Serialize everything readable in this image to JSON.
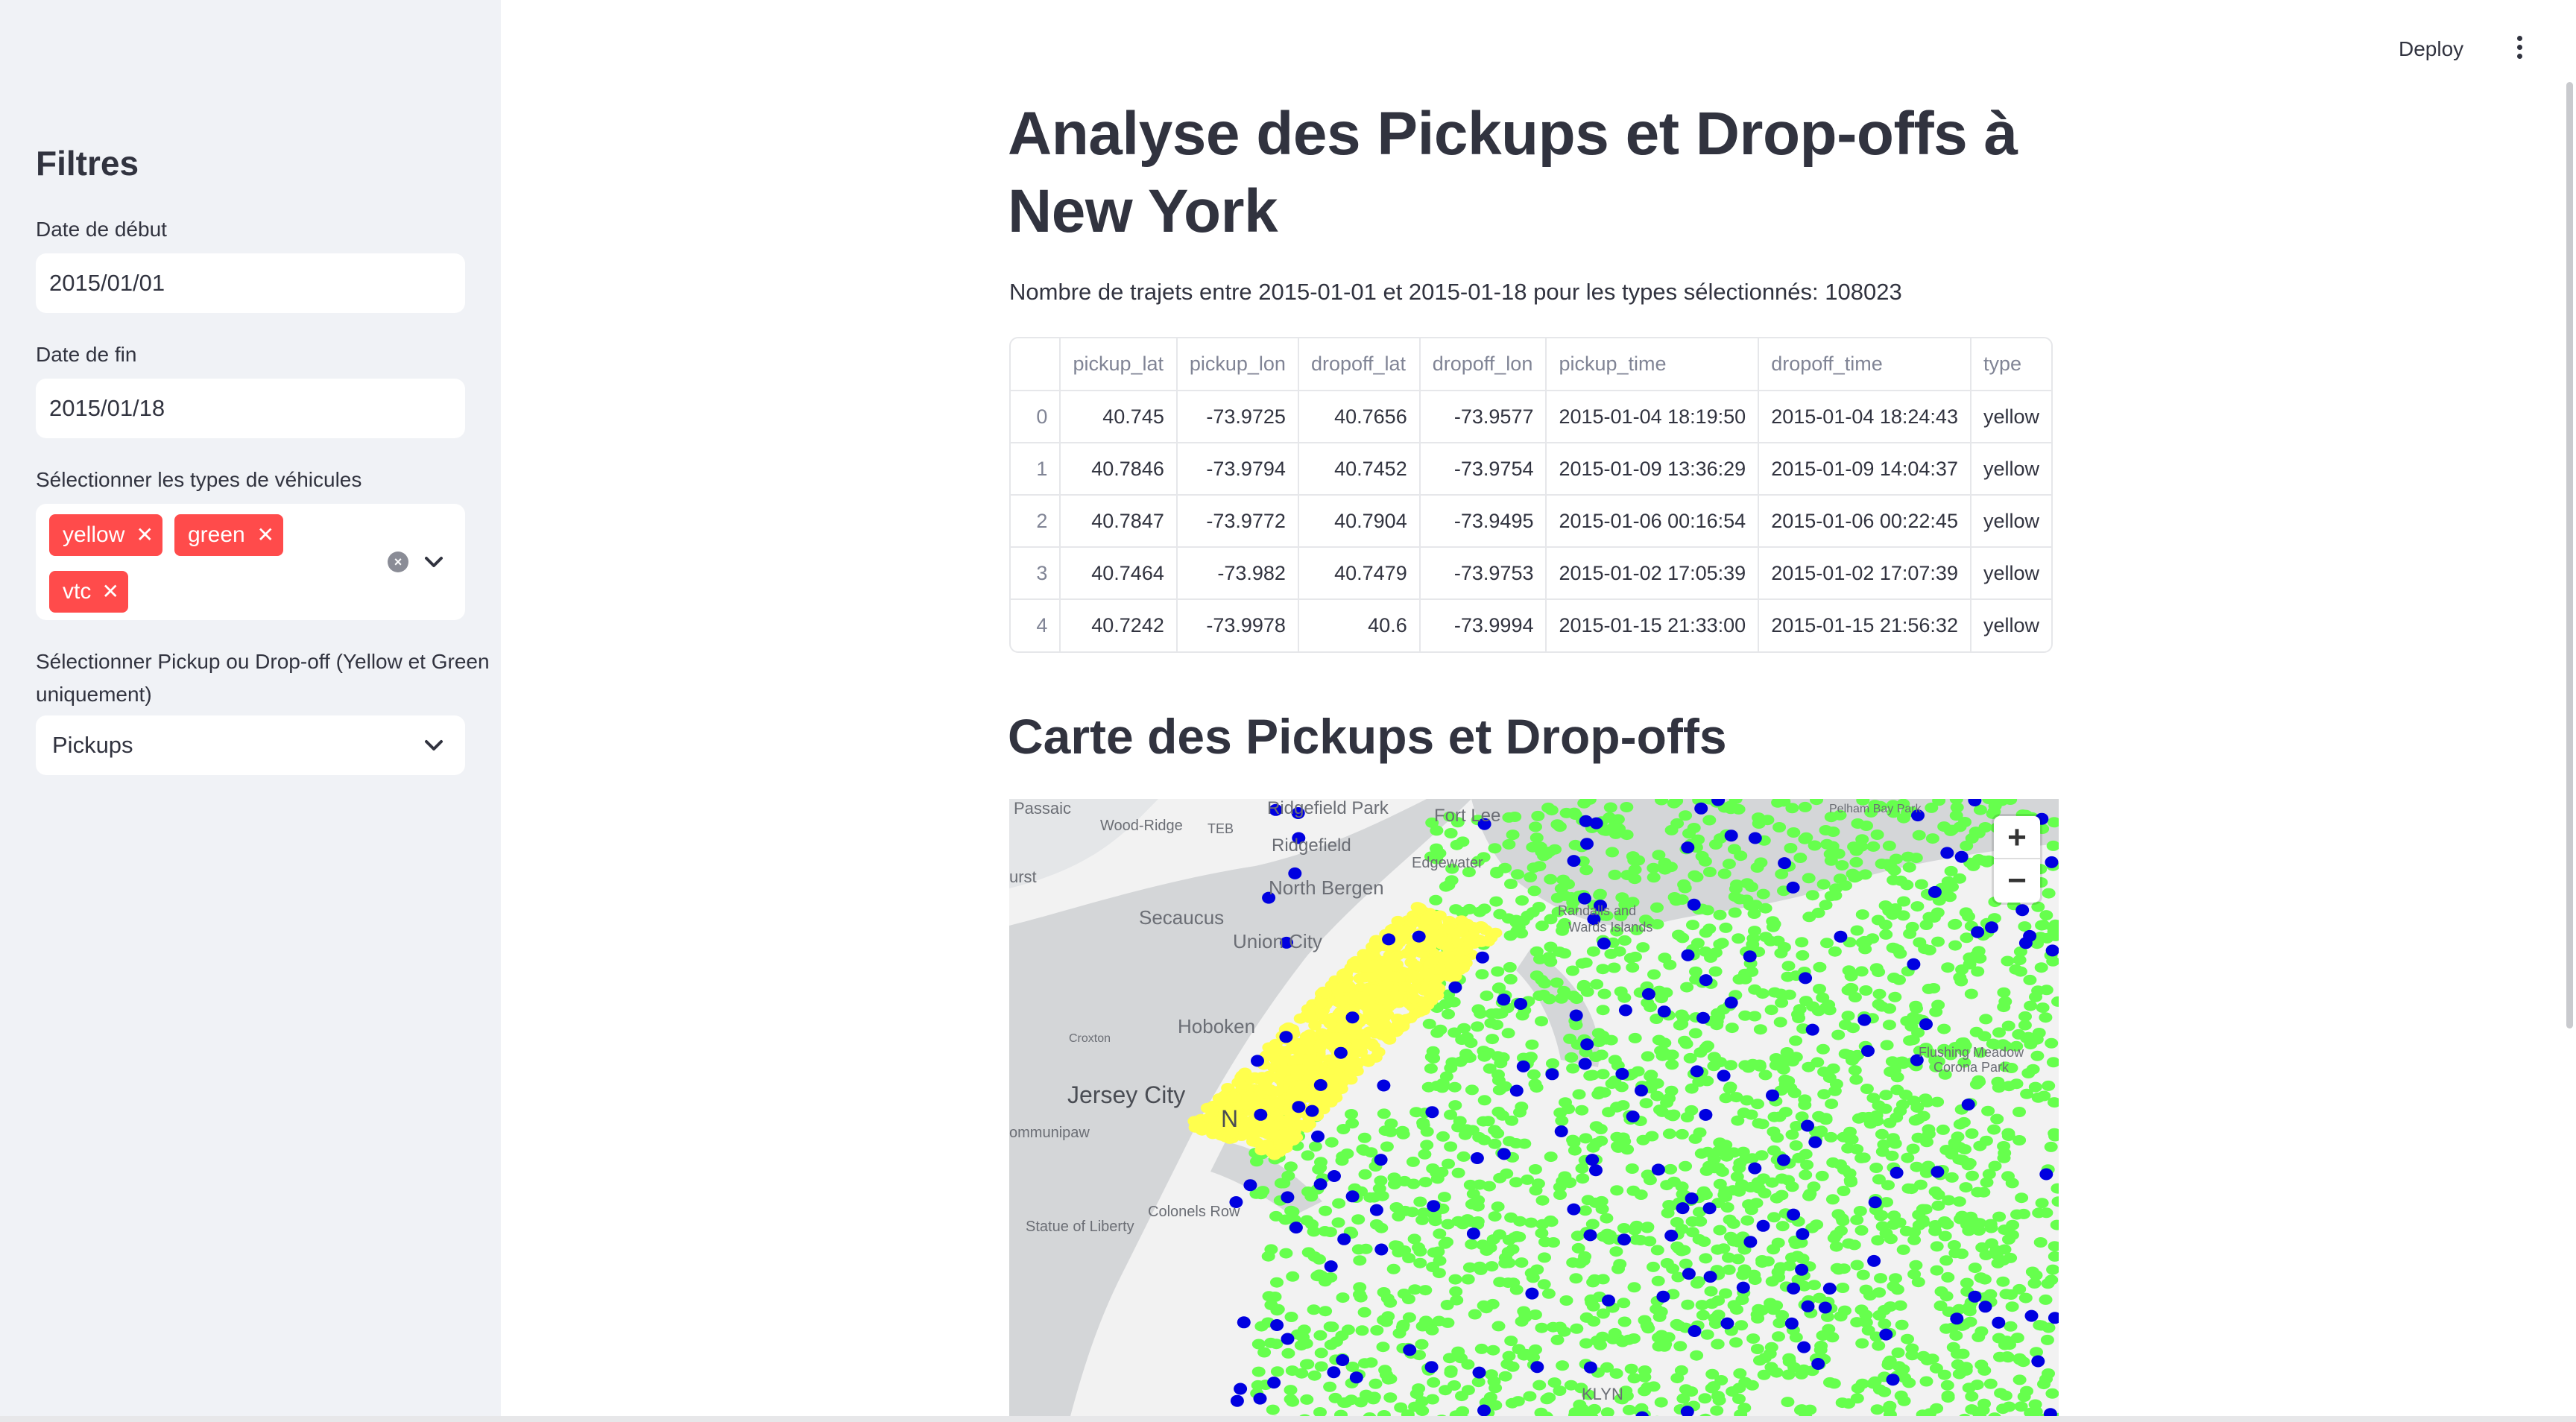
{
  "sidebar": {
    "title": "Filtres",
    "start_date": {
      "label": "Date de début",
      "value": "2015/01/01"
    },
    "end_date": {
      "label": "Date de fin",
      "value": "2015/01/18"
    },
    "vehicle_types": {
      "label": "Sélectionner les types de véhicules",
      "selected": [
        "yellow",
        "green",
        "vtc"
      ],
      "clear_icon": "clear-icon",
      "dropdown_icon": "chevron-down-icon"
    },
    "pickup_dropoff": {
      "label_line1": "Sélectionner Pickup ou Drop-off (Yellow et Green",
      "label_line2": "uniquement)",
      "value": "Pickups"
    }
  },
  "header": {
    "deploy_label": "Deploy",
    "menu_icon": "vertical-dots-icon"
  },
  "main": {
    "title": "Analyse des Pickups et Drop-offs à New York",
    "info": "Nombre de trajets entre 2015-01-01 et 2015-01-18 pour les types sélectionnés: 108023",
    "table": {
      "columns": [
        "",
        "pickup_lat",
        "pickup_lon",
        "dropoff_lat",
        "dropoff_lon",
        "pickup_time",
        "dropoff_time",
        "type"
      ],
      "rows": [
        [
          "0",
          "40.745",
          "-73.9725",
          "40.7656",
          "-73.9577",
          "2015-01-04 18:19:50",
          "2015-01-04 18:24:43",
          "yellow"
        ],
        [
          "1",
          "40.7846",
          "-73.9794",
          "40.7452",
          "-73.9754",
          "2015-01-09 13:36:29",
          "2015-01-09 14:04:37",
          "yellow"
        ],
        [
          "2",
          "40.7847",
          "-73.9772",
          "40.7904",
          "-73.9495",
          "2015-01-06 00:16:54",
          "2015-01-06 00:22:45",
          "yellow"
        ],
        [
          "3",
          "40.7464",
          "-73.982",
          "40.7479",
          "-73.9753",
          "2015-01-02 17:05:39",
          "2015-01-02 17:07:39",
          "yellow"
        ],
        [
          "4",
          "40.7242",
          "-73.9978",
          "40.6",
          "-73.9994",
          "2015-01-15 21:33:00",
          "2015-01-15 21:56:32",
          "yellow"
        ]
      ]
    },
    "map_section_title": "Carte des Pickups et Drop-offs",
    "map": {
      "zoom_in": "+",
      "zoom_out": "−",
      "labels": [
        "Passaic",
        "Wood-Ridge",
        "TEB",
        "Ridgefield Park",
        "Fort Lee",
        "Ridgefield",
        "Edgewater",
        "North Bergen",
        "Secaucus",
        "Union City",
        "Randalls and",
        "Wards Islands",
        "Hoboken",
        "Jersey City",
        "Flushing Meadow",
        "Corona Park",
        "Colonels Row",
        "Statue of Liberty",
        "Pelham Bay Park",
        "urst",
        "Croxton",
        "ommunipaw",
        "N",
        "KLYN"
      ],
      "colors": {
        "yellow": "#ffff4d",
        "green": "#66ff4d",
        "vtc": "#0000e0",
        "water": "#d4d6d8",
        "land": "#f2f2f2"
      }
    }
  }
}
